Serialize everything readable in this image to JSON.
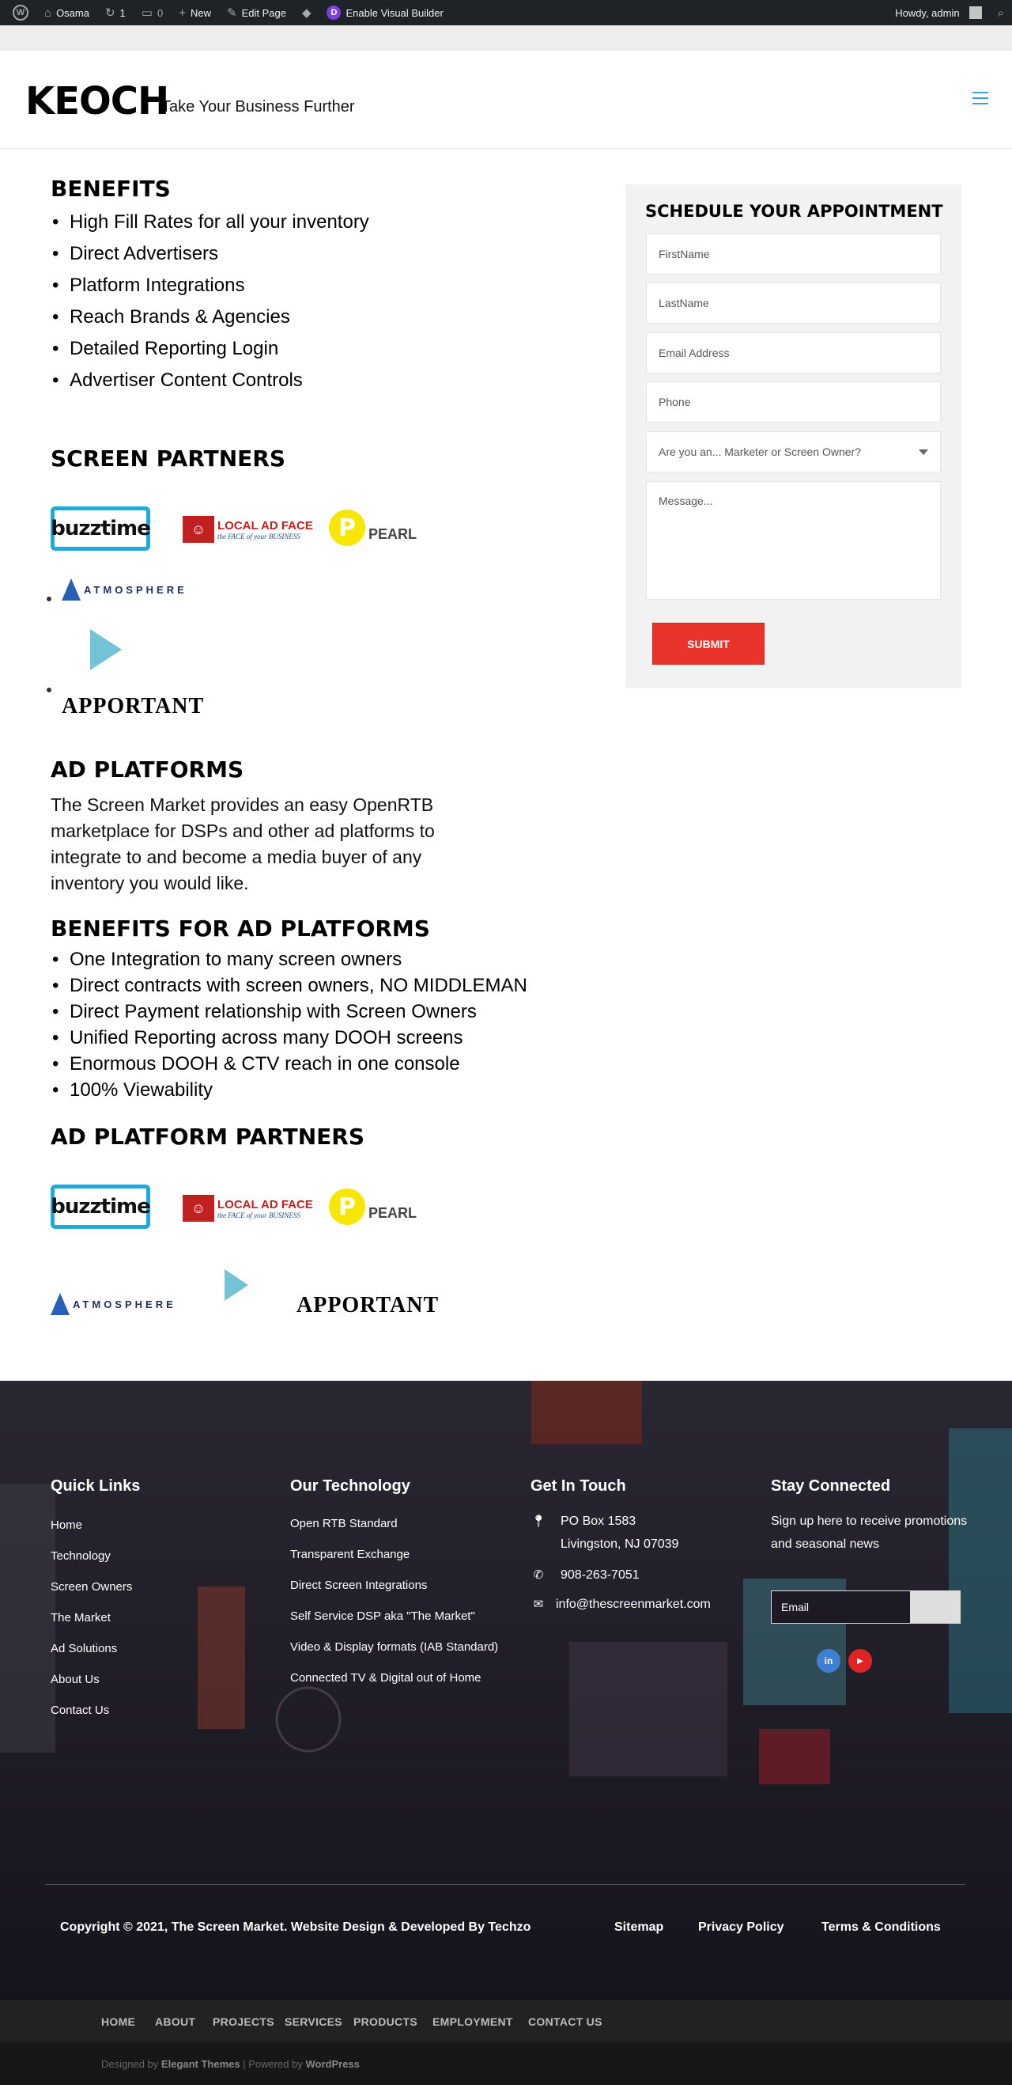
{
  "adminbar": {
    "site_name": "Osama",
    "updates_count": "1",
    "comments_count": "0",
    "new_label": "New",
    "edit_label": "Edit Page",
    "visual_builder_label": "Enable Visual Builder",
    "howdy": "Howdy, admin"
  },
  "header": {
    "logo": "KEOCH",
    "tagline": "Take Your Business Further"
  },
  "benefits": {
    "title": "BENEFITS",
    "items": [
      "High Fill Rates for all your inventory",
      "Direct Advertisers",
      "Platform Integrations",
      "Reach Brands & Agencies",
      "Detailed Reporting Login",
      "Advertiser Content Controls"
    ]
  },
  "screen_partners": {
    "title": "SCREEN PARTNERS"
  },
  "logos": {
    "buzztime": "buzztime",
    "laf_square": "☺",
    "laf_main": "LOCAL AD FACE",
    "laf_sub": "the FACE of your BUSINESS",
    "pearl_letter": "P",
    "pearl": "PEARL",
    "atmosphere": "ATMOSPHERE",
    "apportant": "APPORTANT"
  },
  "ad_platforms": {
    "title": "AD PLATFORMS",
    "text": "The Screen Market provides an easy OpenRTB marketplace for DSPs and other ad platforms to integrate to and become a media buyer of any inventory you would like."
  },
  "benefits_ad": {
    "title": "BENEFITS FOR AD PLATFORMS",
    "items": [
      "One Integration to many screen owners",
      "Direct contracts with screen owners, NO MIDDLEMAN",
      "Direct Payment relationship with Screen Owners",
      "Unified Reporting across many DOOH screens",
      "Enormous DOOH & CTV reach in one console",
      "100% Viewability"
    ]
  },
  "ad_partners": {
    "title": "AD PLATFORM PARTNERS"
  },
  "form": {
    "title": "SCHEDULE YOUR APPOINTMENT",
    "firstname": "FirstName",
    "lastname": "LastName",
    "email": "Email Address",
    "phone": "Phone",
    "role": "Are you an... Marketer or Screen Owner?",
    "message": "Message...",
    "submit": "SUBMIT"
  },
  "footer": {
    "quick_links_title": "Quick Links",
    "quick_links": [
      "Home",
      "Technology",
      "Screen Owners",
      "The Market",
      "Ad Solutions",
      "About Us",
      "Contact Us"
    ],
    "tech_title": "Our Technology",
    "tech_links": [
      "Open RTB Standard",
      "Transparent Exchange",
      "Direct Screen Integrations",
      "Self Service DSP aka \"The Market\"",
      "Video & Display formats (IAB Standard)",
      "Connected TV & Digital out of Home"
    ],
    "touch_title": "Get In Touch",
    "address_1": "PO Box 1583",
    "address_2": "Livingston, NJ 07039",
    "phone": "908-263-7051",
    "email": "info@thescreenmarket.com",
    "stay_title": "Stay Connected",
    "stay_text": "Sign up here to receive promotions and seasonal news",
    "email_placeholder": "Email",
    "linkedin": "in",
    "youtube": "▶",
    "copyright": "Copyright © 2021, The Screen Market. Website Design & Developed By Techzo",
    "sitemap": "Sitemap",
    "privacy": "Privacy Policy",
    "terms": "Terms & Conditions"
  },
  "bottom_nav": [
    "HOME",
    "ABOUT",
    "PROJECTS",
    "SERVICES",
    "PRODUCTS",
    "EMPLOYMENT",
    "CONTACT US"
  ],
  "credits": {
    "designed_by": "Designed by",
    "elegant": "Elegant Themes",
    "sep": " | Powered by ",
    "wordpress": "WordPress"
  },
  "colors": {
    "accent": "#2ea3f2",
    "submit": "#e8342b",
    "footer_bg": "#1d1a26",
    "linkedin": "#3f7fd1",
    "youtube": "#e02424"
  }
}
